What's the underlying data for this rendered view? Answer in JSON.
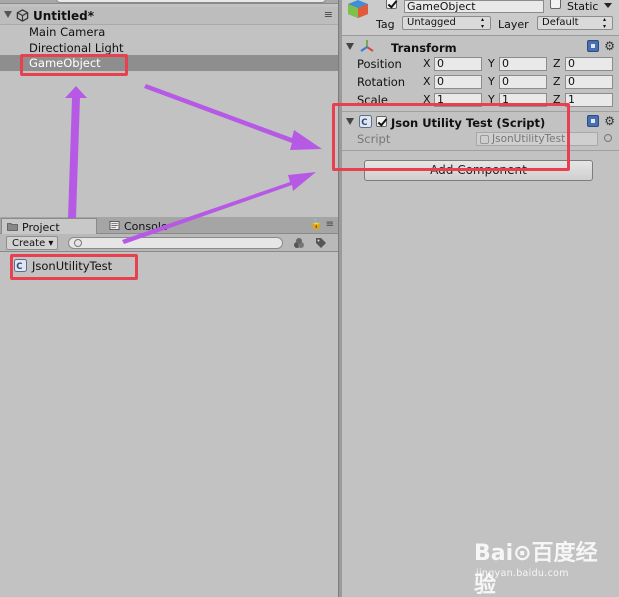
{
  "hierarchy": {
    "tab_label": "Create",
    "scene_name": "Untitled*",
    "menu_glyph": "≡",
    "items": [
      {
        "label": "Main Camera"
      },
      {
        "label": "Directional Light"
      },
      {
        "label": "GameObject",
        "selected": true
      }
    ]
  },
  "project": {
    "tabs": [
      {
        "label": "Project",
        "active": true
      },
      {
        "label": "Console",
        "active": false
      }
    ],
    "create_label": "Create",
    "assets": [
      {
        "label": "JsonUtilityTest",
        "icon": "csharp-script-icon"
      }
    ]
  },
  "inspector": {
    "object_name": "GameObject",
    "static_label": "Static",
    "tag_label": "Tag",
    "tag_value": "Untagged",
    "layer_label": "Layer",
    "layer_value": "Default",
    "transform": {
      "title": "Transform",
      "rows": [
        {
          "label": "Position",
          "x": "0",
          "y": "0",
          "z": "0"
        },
        {
          "label": "Rotation",
          "x": "0",
          "y": "0",
          "z": "0"
        },
        {
          "label": "Scale",
          "x": "1",
          "y": "1",
          "z": "1"
        }
      ],
      "axis_x": "X",
      "axis_y": "Y",
      "axis_z": "Z"
    },
    "script_component": {
      "title": "Json Utility Test (Script)",
      "script_label": "Script",
      "script_value": "JsonUtilityTest"
    },
    "add_component_label": "Add Component"
  },
  "watermark": {
    "logo": "Bai⊙百度经验",
    "url": "jingyan.baidu.com"
  },
  "colors": {
    "highlight": "#e8404f",
    "arrow": "#b65ae6",
    "selection": "#8e8e8e"
  }
}
